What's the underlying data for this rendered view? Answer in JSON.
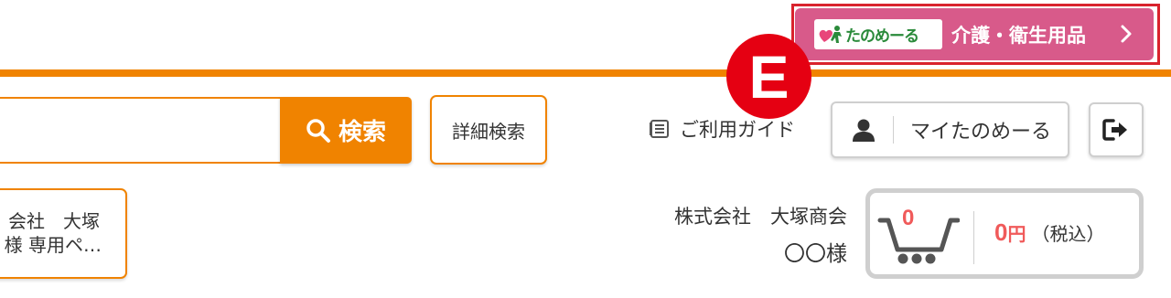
{
  "header": {
    "care_banner": {
      "logo_text": "たのめーる",
      "label": "介護・衛生用品",
      "chevron": "chevron-right-icon"
    },
    "marker_label": "E"
  },
  "search": {
    "input_value": "",
    "button_label": "検索",
    "detail_label": "詳細検索"
  },
  "nav": {
    "guide_label": "ご利用ガイド",
    "my_page_label": "マイたのめーる"
  },
  "catalog_card": {
    "line1": "会社　大塚",
    "line2": "様 専用ペ…"
  },
  "user": {
    "company": "株式会社　大塚商会",
    "name": "〇〇様"
  },
  "cart": {
    "count": "0",
    "amount": "0",
    "unit": "円",
    "tax_note": "（税込）"
  },
  "colors": {
    "accent": "#f08300",
    "care_pink": "#d85a8a",
    "marker_red": "#e50012",
    "price_red": "#f05a5a"
  }
}
